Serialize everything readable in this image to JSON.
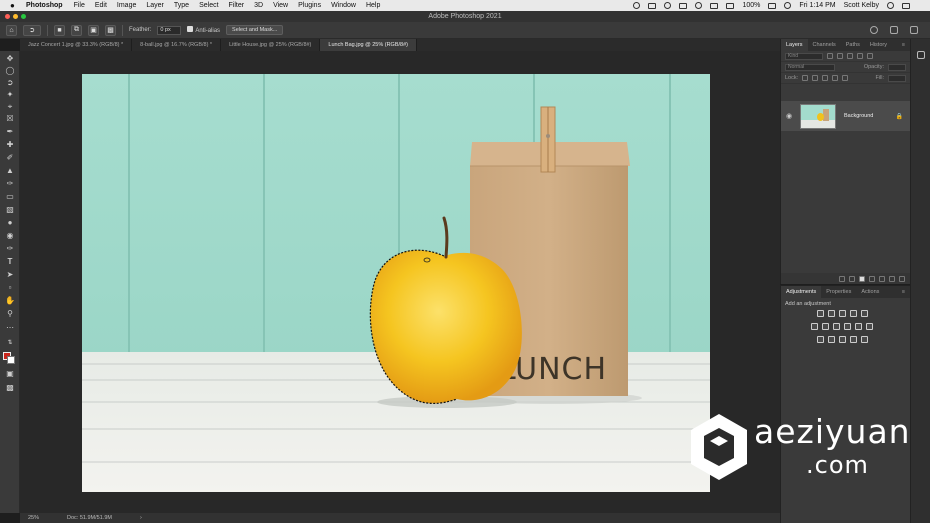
{
  "menubar": {
    "apple": "",
    "app_name": "Photoshop",
    "items": [
      "File",
      "Edit",
      "Image",
      "Layer",
      "Type",
      "Select",
      "Filter",
      "3D",
      "View",
      "Plugins",
      "Window",
      "Help"
    ],
    "battery": "100%",
    "clock": "Fri 1:14 PM",
    "user": "Scott Kelby"
  },
  "titlebar": {
    "title": "Adobe Photoshop 2021"
  },
  "options": {
    "feather_label": "Feather:",
    "feather_value": "0 px",
    "antialias_label": "Anti-alias",
    "select_mask": "Select and Mask..."
  },
  "tabs": [
    {
      "label": "Jazz Concert 1.jpg @ 33.3% (RGB/8) *"
    },
    {
      "label": "8-ball.jpg @ 16.7% (RGB/8) *"
    },
    {
      "label": "Little House.jpg @ 25% (RGB/8#)"
    },
    {
      "label": "Lunch Bag.jpg @ 25% (RGB/8#)"
    }
  ],
  "layers_panel": {
    "tabs": [
      "Layers",
      "Channels",
      "Paths",
      "History"
    ],
    "kind_placeholder": "Kind",
    "blend_mode": "Normal",
    "opacity_label": "Opacity:",
    "lock_label": "Lock:",
    "fill_label": "Fill:",
    "layer_name": "Background"
  },
  "adjustments_panel": {
    "tabs": [
      "Adjustments",
      "Properties",
      "Actions"
    ],
    "subtitle": "Add an adjustment"
  },
  "photo": {
    "bag_text": "LUNCH"
  },
  "status": {
    "zoom": "25%",
    "doc": "Doc: 51.9M/51.9M"
  },
  "watermark": {
    "line1": "aeziyuan",
    "line2": ".com"
  },
  "colors": {
    "wall": "#9fdacb",
    "table": "#e9ebe6",
    "apple": "#f3c51f",
    "bag": "#c9a47a",
    "foreground_color": "#c8261d",
    "background_color": "#ffffff"
  },
  "tools": [
    "move-tool",
    "marquee-tool",
    "lasso-tool",
    "quick-select-tool",
    "crop-tool",
    "frame-tool",
    "eyedropper-tool",
    "healing-tool",
    "brush-tool",
    "stamp-tool",
    "history-brush-tool",
    "eraser-tool",
    "gradient-tool",
    "blur-tool",
    "dodge-tool",
    "pen-tool",
    "type-tool",
    "path-select-tool",
    "shape-tool",
    "hand-tool",
    "zoom-tool",
    "more-tools"
  ]
}
